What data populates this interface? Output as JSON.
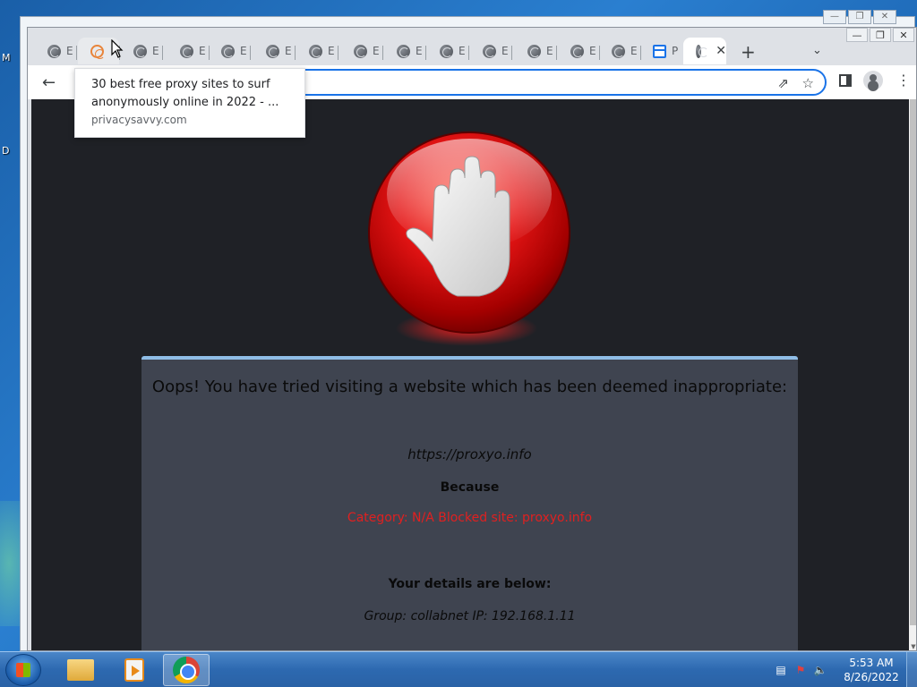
{
  "desktop": {
    "label_1": "M",
    "label_2": "D"
  },
  "browser": {
    "tabs": [
      {
        "title": "E",
        "favicon": "globe-icon"
      },
      {
        "title": "",
        "favicon": "spiral-icon",
        "hovered": true
      },
      {
        "title": "E",
        "favicon": "globe-icon"
      },
      {
        "title": "E",
        "favicon": "globe-icon"
      },
      {
        "title": "E",
        "favicon": "globe-icon"
      },
      {
        "title": "E",
        "favicon": "globe-icon"
      },
      {
        "title": "E",
        "favicon": "globe-icon"
      },
      {
        "title": "E",
        "favicon": "globe-icon"
      },
      {
        "title": "E",
        "favicon": "globe-icon"
      },
      {
        "title": "E",
        "favicon": "globe-icon"
      },
      {
        "title": "E",
        "favicon": "globe-icon"
      },
      {
        "title": "E",
        "favicon": "globe-icon"
      },
      {
        "title": "E",
        "favicon": "globe-icon"
      },
      {
        "title": "E",
        "favicon": "globe-icon"
      },
      {
        "title": "P",
        "favicon": "document-icon"
      },
      {
        "title": "",
        "favicon": "globe-icon",
        "active": true
      }
    ],
    "new_tab_label": "+",
    "tab_search_label": "⌄",
    "win_minimize": "—",
    "win_restore": "❐",
    "win_close": "✕"
  },
  "tooltip": {
    "title": "30 best free proxy sites to surf anonymously online in 2022 - ...",
    "url": "privacysavvy.com"
  },
  "blockpage": {
    "heading": "Oops! You have tried visiting a website which has been deemed inappropriate:",
    "blocked_url": "https://proxyo.info",
    "because": "Because",
    "reason": "Category: N/A   Blocked site: proxyo.info",
    "details_heading": "Your details are below:",
    "details": "Group: collabnet   IP: 192.168.1.11"
  },
  "taskbar": {
    "clock_time": "5:53 AM",
    "clock_date": "8/26/2022"
  },
  "colors": {
    "accent": "#1a73e8",
    "page_bg": "#1f2126",
    "panel_bg": "#3f4450",
    "panel_border": "#8fbde6",
    "reason_red": "#e02020"
  }
}
